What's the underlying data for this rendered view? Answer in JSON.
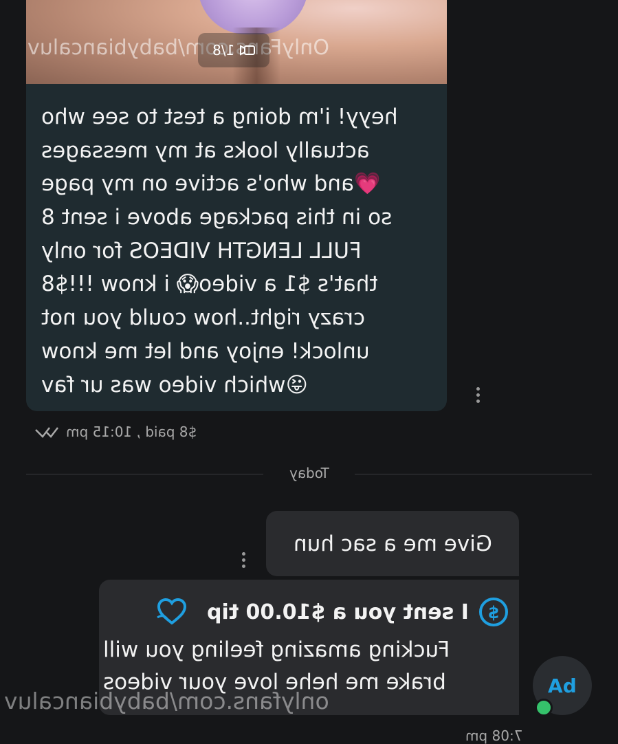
{
  "media": {
    "watermark": "OnlyFans.com/babybiancaluv",
    "counter": "1/8"
  },
  "message": {
    "lines": [
      "heyy! i'm doing a test to see who",
      "actually looks at my messages",
      "and who's active on my page💗",
      "so in this package above i sent 8",
      "FULL LENGTH VIDEOS for only",
      "$8!!! that's $1 a video😱 i know",
      "crazy right..how could you not",
      "unlock! enjoy and let me know",
      "which video was ur fav😜"
    ],
    "meta": "$8 paid , 10:15 pm"
  },
  "divider": {
    "label": "Today"
  },
  "outgoing": {
    "text": "Give me a sac hun",
    "tip_title": "I sent you a $10.00 tip",
    "tip_lines": [
      "Fucking amazing feeling you will",
      "brake me hehe love your videos"
    ],
    "time": "7:08 pm"
  },
  "avatar": {
    "initials": "bA",
    "status_color": "#35c26b"
  },
  "watermark": "onlyfans.com/babybiancaluv",
  "colors": {
    "background": "#151618",
    "incoming_bubble": "#1f2b30",
    "outgoing_bubble": "#2a2b2e",
    "accent": "#1f9fe0"
  }
}
